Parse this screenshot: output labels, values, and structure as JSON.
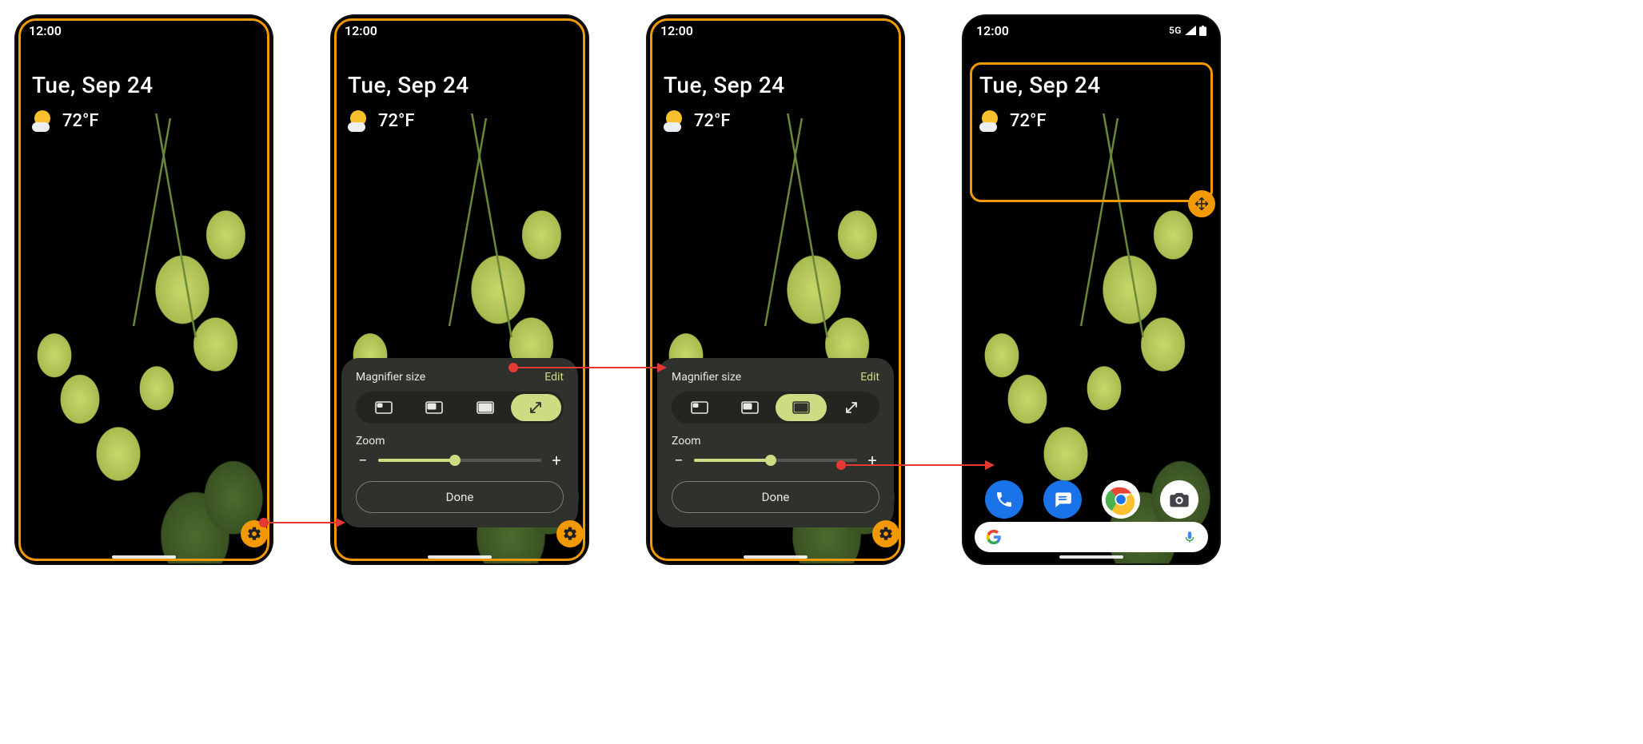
{
  "status": {
    "time": "12:00",
    "network": "5G"
  },
  "home": {
    "date": "Tue, Sep 24",
    "temp": "72°F"
  },
  "panel": {
    "size_label": "Magnifier size",
    "edit": "Edit",
    "zoom_label": "Zoom",
    "done": "Done",
    "zoom_fraction": 0.47,
    "options": [
      "small",
      "medium",
      "large",
      "fullscreen"
    ],
    "selected_b": "fullscreen",
    "selected_c": "large"
  },
  "colors": {
    "highlight": "#F29900",
    "accent": "#cddc82",
    "panel_bg": "#2e312c"
  },
  "dock": [
    "phone",
    "messages",
    "chrome",
    "camera"
  ]
}
